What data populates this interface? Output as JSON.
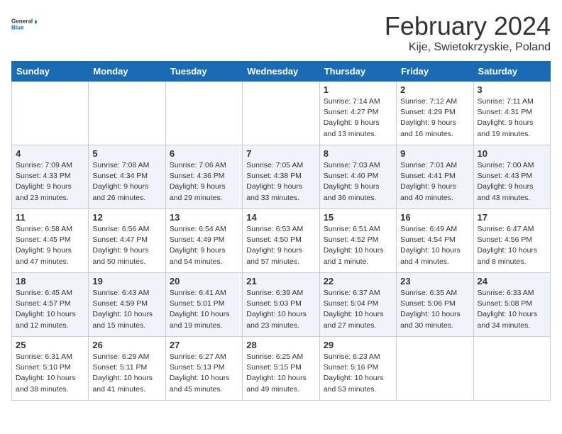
{
  "logo": {
    "text_general": "General",
    "text_blue": "Blue"
  },
  "header": {
    "title": "February 2024",
    "subtitle": "Kije, Swietokrzyskie, Poland"
  },
  "days_of_week": [
    "Sunday",
    "Monday",
    "Tuesday",
    "Wednesday",
    "Thursday",
    "Friday",
    "Saturday"
  ],
  "weeks": [
    [
      {
        "day": "",
        "info": ""
      },
      {
        "day": "",
        "info": ""
      },
      {
        "day": "",
        "info": ""
      },
      {
        "day": "",
        "info": ""
      },
      {
        "day": "1",
        "info": "Sunrise: 7:14 AM\nSunset: 4:27 PM\nDaylight: 9 hours\nand 13 minutes."
      },
      {
        "day": "2",
        "info": "Sunrise: 7:12 AM\nSunset: 4:29 PM\nDaylight: 9 hours\nand 16 minutes."
      },
      {
        "day": "3",
        "info": "Sunrise: 7:11 AM\nSunset: 4:31 PM\nDaylight: 9 hours\nand 19 minutes."
      }
    ],
    [
      {
        "day": "4",
        "info": "Sunrise: 7:09 AM\nSunset: 4:33 PM\nDaylight: 9 hours\nand 23 minutes."
      },
      {
        "day": "5",
        "info": "Sunrise: 7:08 AM\nSunset: 4:34 PM\nDaylight: 9 hours\nand 26 minutes."
      },
      {
        "day": "6",
        "info": "Sunrise: 7:06 AM\nSunset: 4:36 PM\nDaylight: 9 hours\nand 29 minutes."
      },
      {
        "day": "7",
        "info": "Sunrise: 7:05 AM\nSunset: 4:38 PM\nDaylight: 9 hours\nand 33 minutes."
      },
      {
        "day": "8",
        "info": "Sunrise: 7:03 AM\nSunset: 4:40 PM\nDaylight: 9 hours\nand 36 minutes."
      },
      {
        "day": "9",
        "info": "Sunrise: 7:01 AM\nSunset: 4:41 PM\nDaylight: 9 hours\nand 40 minutes."
      },
      {
        "day": "10",
        "info": "Sunrise: 7:00 AM\nSunset: 4:43 PM\nDaylight: 9 hours\nand 43 minutes."
      }
    ],
    [
      {
        "day": "11",
        "info": "Sunrise: 6:58 AM\nSunset: 4:45 PM\nDaylight: 9 hours\nand 47 minutes."
      },
      {
        "day": "12",
        "info": "Sunrise: 6:56 AM\nSunset: 4:47 PM\nDaylight: 9 hours\nand 50 minutes."
      },
      {
        "day": "13",
        "info": "Sunrise: 6:54 AM\nSunset: 4:49 PM\nDaylight: 9 hours\nand 54 minutes."
      },
      {
        "day": "14",
        "info": "Sunrise: 6:53 AM\nSunset: 4:50 PM\nDaylight: 9 hours\nand 57 minutes."
      },
      {
        "day": "15",
        "info": "Sunrise: 6:51 AM\nSunset: 4:52 PM\nDaylight: 10 hours\nand 1 minute."
      },
      {
        "day": "16",
        "info": "Sunrise: 6:49 AM\nSunset: 4:54 PM\nDaylight: 10 hours\nand 4 minutes."
      },
      {
        "day": "17",
        "info": "Sunrise: 6:47 AM\nSunset: 4:56 PM\nDaylight: 10 hours\nand 8 minutes."
      }
    ],
    [
      {
        "day": "18",
        "info": "Sunrise: 6:45 AM\nSunset: 4:57 PM\nDaylight: 10 hours\nand 12 minutes."
      },
      {
        "day": "19",
        "info": "Sunrise: 6:43 AM\nSunset: 4:59 PM\nDaylight: 10 hours\nand 15 minutes."
      },
      {
        "day": "20",
        "info": "Sunrise: 6:41 AM\nSunset: 5:01 PM\nDaylight: 10 hours\nand 19 minutes."
      },
      {
        "day": "21",
        "info": "Sunrise: 6:39 AM\nSunset: 5:03 PM\nDaylight: 10 hours\nand 23 minutes."
      },
      {
        "day": "22",
        "info": "Sunrise: 6:37 AM\nSunset: 5:04 PM\nDaylight: 10 hours\nand 27 minutes."
      },
      {
        "day": "23",
        "info": "Sunrise: 6:35 AM\nSunset: 5:06 PM\nDaylight: 10 hours\nand 30 minutes."
      },
      {
        "day": "24",
        "info": "Sunrise: 6:33 AM\nSunset: 5:08 PM\nDaylight: 10 hours\nand 34 minutes."
      }
    ],
    [
      {
        "day": "25",
        "info": "Sunrise: 6:31 AM\nSunset: 5:10 PM\nDaylight: 10 hours\nand 38 minutes."
      },
      {
        "day": "26",
        "info": "Sunrise: 6:29 AM\nSunset: 5:11 PM\nDaylight: 10 hours\nand 41 minutes."
      },
      {
        "day": "27",
        "info": "Sunrise: 6:27 AM\nSunset: 5:13 PM\nDaylight: 10 hours\nand 45 minutes."
      },
      {
        "day": "28",
        "info": "Sunrise: 6:25 AM\nSunset: 5:15 PM\nDaylight: 10 hours\nand 49 minutes."
      },
      {
        "day": "29",
        "info": "Sunrise: 6:23 AM\nSunset: 5:16 PM\nDaylight: 10 hours\nand 53 minutes."
      },
      {
        "day": "",
        "info": ""
      },
      {
        "day": "",
        "info": ""
      }
    ]
  ]
}
